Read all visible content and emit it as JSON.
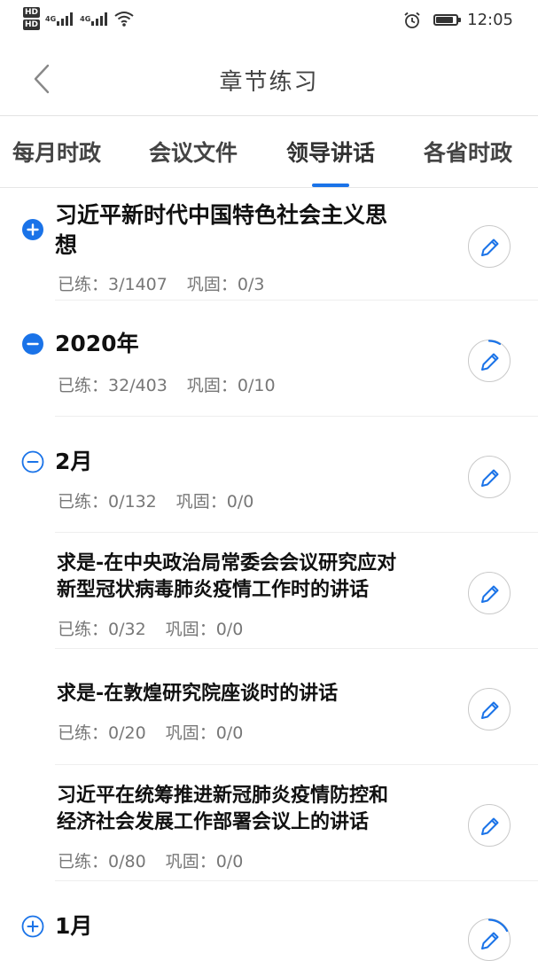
{
  "status_bar": {
    "hd1": "HD",
    "hd2": "HD",
    "net1": "4G",
    "net2": "4G",
    "time": "12:05"
  },
  "header": {
    "title": "章节练习"
  },
  "tabs": [
    {
      "label": "每月时政",
      "active": false
    },
    {
      "label": "会议文件",
      "active": false
    },
    {
      "label": "领导讲话",
      "active": true
    },
    {
      "label": "各省时政",
      "active": false
    }
  ],
  "meta_labels": {
    "practiced": "已练：",
    "consolidate": "巩固："
  },
  "items": [
    {
      "title_line1": "习近平新时代中国特色社会主义思",
      "title_line2": "想",
      "practiced": "3/1407",
      "consolidate": "0/3",
      "icon": "plus-filled-icon"
    },
    {
      "title_line1": "2020年",
      "title_line2": "",
      "practiced": "32/403",
      "consolidate": "0/10",
      "icon": "minus-filled-icon"
    },
    {
      "title_line1": "2月",
      "title_line2": "",
      "practiced": "0/132",
      "consolidate": "0/0",
      "icon": "minus-outline-icon"
    },
    {
      "title_line1": "求是-在中央政治局常委会会议研究应对",
      "title_line2": "新型冠状病毒肺炎疫情工作时的讲话",
      "practiced": "0/32",
      "consolidate": "0/0",
      "icon": ""
    },
    {
      "title_line1": "求是-在敦煌研究院座谈时的讲话",
      "title_line2": "",
      "practiced": "0/20",
      "consolidate": "0/0",
      "icon": ""
    },
    {
      "title_line1": "习近平在统筹推进新冠肺炎疫情防控和",
      "title_line2": "经济社会发展工作部署会议上的讲话",
      "practiced": "0/80",
      "consolidate": "0/0",
      "icon": ""
    },
    {
      "title_line1": "1月",
      "title_line2": "",
      "practiced": "",
      "consolidate": "",
      "icon": "plus-outline-icon"
    }
  ],
  "colors": {
    "accent": "#1a73e8",
    "text": "#111111",
    "muted": "#777777"
  }
}
